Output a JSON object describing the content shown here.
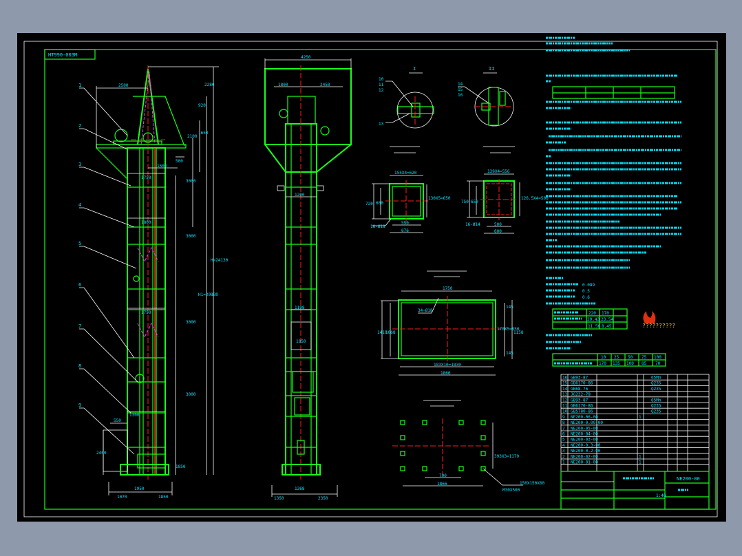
{
  "drawing": {
    "drawing_code": "HT990-003M",
    "colors": {
      "background": "#8e9aab",
      "paper": "#000000",
      "frame": "#ffffff",
      "outline": "#19ff19",
      "centerline": "#ff1a1a",
      "text": "#00e5ff"
    },
    "left_view": {
      "callouts": [
        "1",
        "2",
        "3",
        "4",
        "5",
        "6",
        "7",
        "8",
        "9"
      ],
      "dims": {
        "top_width": "2500",
        "d1": "2280",
        "d2": "920",
        "d3": "2100",
        "d4": "1650",
        "d5": "500",
        "d6": "1500",
        "d7": "3000",
        "d8": "1750",
        "d9": "1800",
        "d10": "3000",
        "d11": "3000",
        "d12": "1750",
        "d13": "3000",
        "d14": "2400",
        "d15": "1850",
        "d16": "1950",
        "d17": "1070",
        "d18": "1850",
        "d19": "550",
        "d20": "1300",
        "total_h": "H=24130",
        "h2": "H1=20880"
      }
    },
    "front_view": {
      "dims": {
        "top": "4250",
        "d1": "1800",
        "d2": "2450",
        "d3": "1200",
        "d4": "1198",
        "d5": "1850",
        "d6": "1350",
        "d7": "2350",
        "d8": "1268"
      }
    },
    "detail_views": {
      "view_i": {
        "label": "I",
        "callouts": [
          "10",
          "11",
          "12",
          "13"
        ]
      },
      "view_ii": {
        "label": "II",
        "callouts": [
          "14",
          "15",
          "16"
        ]
      },
      "inlet": {
        "dims": {
          "top": "155X4=620",
          "h1": "720",
          "h2": "600",
          "side": "130X5=650",
          "w1": "550",
          "w2": "676",
          "holes": "18-Ø18"
        }
      },
      "outlet": {
        "dims": {
          "top": "139X4=556",
          "h1": "750",
          "h2": "650",
          "side": "126.5X4=506",
          "w1": "500",
          "w2": "600",
          "holes": "16-Ø14"
        }
      },
      "base_flange": {
        "dims": {
          "top": "1750",
          "h1": "1410",
          "h2": "1068",
          "holes": "34-Ø18",
          "side": "170X5=850",
          "s1": "145",
          "s2": "145",
          "total": "1158",
          "bottom": "183X10=1830",
          "bottom2": "1866"
        }
      },
      "foundation": {
        "dims": {
          "spacing": "700",
          "width": "1866",
          "side": "393X3=1179",
          "bolt": "M30X500",
          "pad": "150X150X60"
        }
      }
    },
    "notes": {
      "performance_table": [
        [
          "220",
          "170"
        ],
        [
          "29.43",
          "23.54"
        ],
        [
          "11.56",
          "8.45"
        ]
      ],
      "efficiency_table": [
        [
          "10",
          "25",
          "50",
          "75",
          "100"
        ],
        [
          "170",
          "135",
          "100",
          "85",
          "70"
        ]
      ],
      "values": {
        "a": "0.089",
        "b": "0.5",
        "c": "0.6"
      },
      "watermark": "??????????"
    },
    "bom": {
      "rows": [
        {
          "no": "16",
          "code": "GB93-87",
          "qty": "",
          "mat": "65Mn"
        },
        {
          "no": "15",
          "code": "GB6170-86",
          "qty": "",
          "mat": "Q235"
        },
        {
          "no": "14",
          "code": "GB68-76",
          "qty": "",
          "mat": "Q235"
        },
        {
          "no": "13",
          "code": "JG232-79",
          "qty": "",
          "mat": ""
        },
        {
          "no": "12",
          "code": "GB93-87",
          "qty": "",
          "mat": "65Mn"
        },
        {
          "no": "11",
          "code": "GB6170-86",
          "qty": "",
          "mat": "Q235"
        },
        {
          "no": "10",
          "code": "GB5780-86",
          "qty": "",
          "mat": "Q235"
        },
        {
          "no": "9",
          "code": "NE200-06-00",
          "qty": "1",
          "mat": ""
        },
        {
          "no": "8",
          "code": "NE200-0.00-00",
          "qty": "",
          "mat": ""
        },
        {
          "no": "7",
          "code": "NE200-05-00",
          "qty": "",
          "mat": ""
        },
        {
          "no": "6",
          "code": "NE200-04-00",
          "qty": "",
          "mat": ""
        },
        {
          "no": "5",
          "code": "NE200-03-00",
          "qty": "",
          "mat": ""
        },
        {
          "no": "4",
          "code": "NE200-0.3-00",
          "qty": "",
          "mat": ""
        },
        {
          "no": "3",
          "code": "NE200-0.2-00",
          "qty": "",
          "mat": ""
        },
        {
          "no": "2",
          "code": "NE200-02-00",
          "qty": "1",
          "mat": ""
        },
        {
          "no": "1",
          "code": "NE200-01-00",
          "qty": "1",
          "mat": ""
        }
      ]
    },
    "title_block": {
      "drawing_no": "NE200-00",
      "scale": "1:40"
    }
  }
}
